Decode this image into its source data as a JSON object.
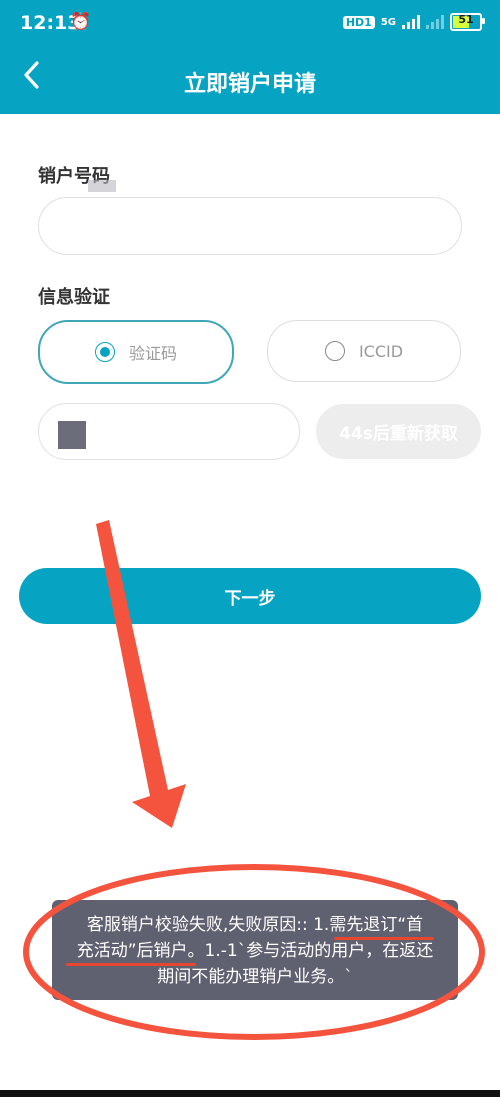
{
  "statusbar": {
    "time": "12:13",
    "hd_label": "HD1",
    "net_label": "5G",
    "battery_level": "51"
  },
  "header": {
    "back_icon": "chevron-left-icon",
    "title": "立即销户申请"
  },
  "form": {
    "account_label": "销户号码",
    "verify_label": "信息验证",
    "option_sms": "验证码",
    "option_iccid": "ICCID",
    "resend_label": "44s后重新获取",
    "next_label": "下一步"
  },
  "toast": {
    "line1": "客服销户校验失败,失败原因:: 1.需先退订“首",
    "line2": "充活动”后销户。1.-1`参与活动的用户，在返还",
    "line3": "期间不能办理销户业务。`"
  },
  "annotation": {
    "arrow_color": "#f4533d",
    "ellipse_color": "#f4533d"
  }
}
